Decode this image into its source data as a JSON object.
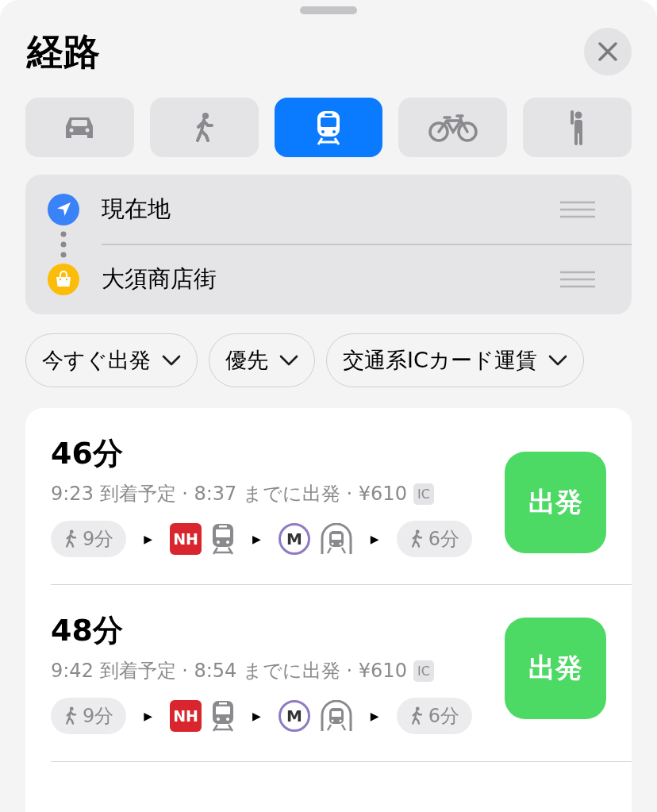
{
  "title": "経路",
  "modes": [
    {
      "kind": "car",
      "selected": false
    },
    {
      "kind": "walk",
      "selected": false
    },
    {
      "kind": "transit",
      "selected": true
    },
    {
      "kind": "bike",
      "selected": false
    },
    {
      "kind": "rideshare",
      "selected": false
    }
  ],
  "locations": [
    {
      "kind": "current",
      "label": "現在地"
    },
    {
      "kind": "shopping",
      "label": "大須商店街"
    }
  ],
  "filters": [
    {
      "label": "今すぐ出発"
    },
    {
      "label": "優先"
    },
    {
      "label": "交通系ICカード運賃"
    }
  ],
  "routes": [
    {
      "duration": "46分",
      "summary": "9:23 到着予定 · 8:37 までに出発 · ¥610",
      "fare_badge": "IC",
      "button": "出発",
      "legs": [
        {
          "kind": "walk",
          "text": "9分"
        },
        {
          "kind": "arrow",
          "text": "▶"
        },
        {
          "kind": "line",
          "text": "NH",
          "color": "#d9262e"
        },
        {
          "kind": "train"
        },
        {
          "kind": "arrow",
          "text": "▶"
        },
        {
          "kind": "metro",
          "text": "M",
          "color": "#8e7cc3"
        },
        {
          "kind": "subway"
        },
        {
          "kind": "arrow",
          "text": "▶"
        },
        {
          "kind": "walk",
          "text": "6分"
        }
      ]
    },
    {
      "duration": "48分",
      "summary": "9:42 到着予定 · 8:54 までに出発 · ¥610",
      "fare_badge": "IC",
      "button": "出発",
      "legs": [
        {
          "kind": "walk",
          "text": "9分"
        },
        {
          "kind": "arrow",
          "text": "▶"
        },
        {
          "kind": "line",
          "text": "NH",
          "color": "#d9262e"
        },
        {
          "kind": "train"
        },
        {
          "kind": "arrow",
          "text": "▶"
        },
        {
          "kind": "metro",
          "text": "M",
          "color": "#8e7cc3"
        },
        {
          "kind": "subway"
        },
        {
          "kind": "arrow",
          "text": "▶"
        },
        {
          "kind": "walk",
          "text": "6分"
        }
      ]
    }
  ]
}
